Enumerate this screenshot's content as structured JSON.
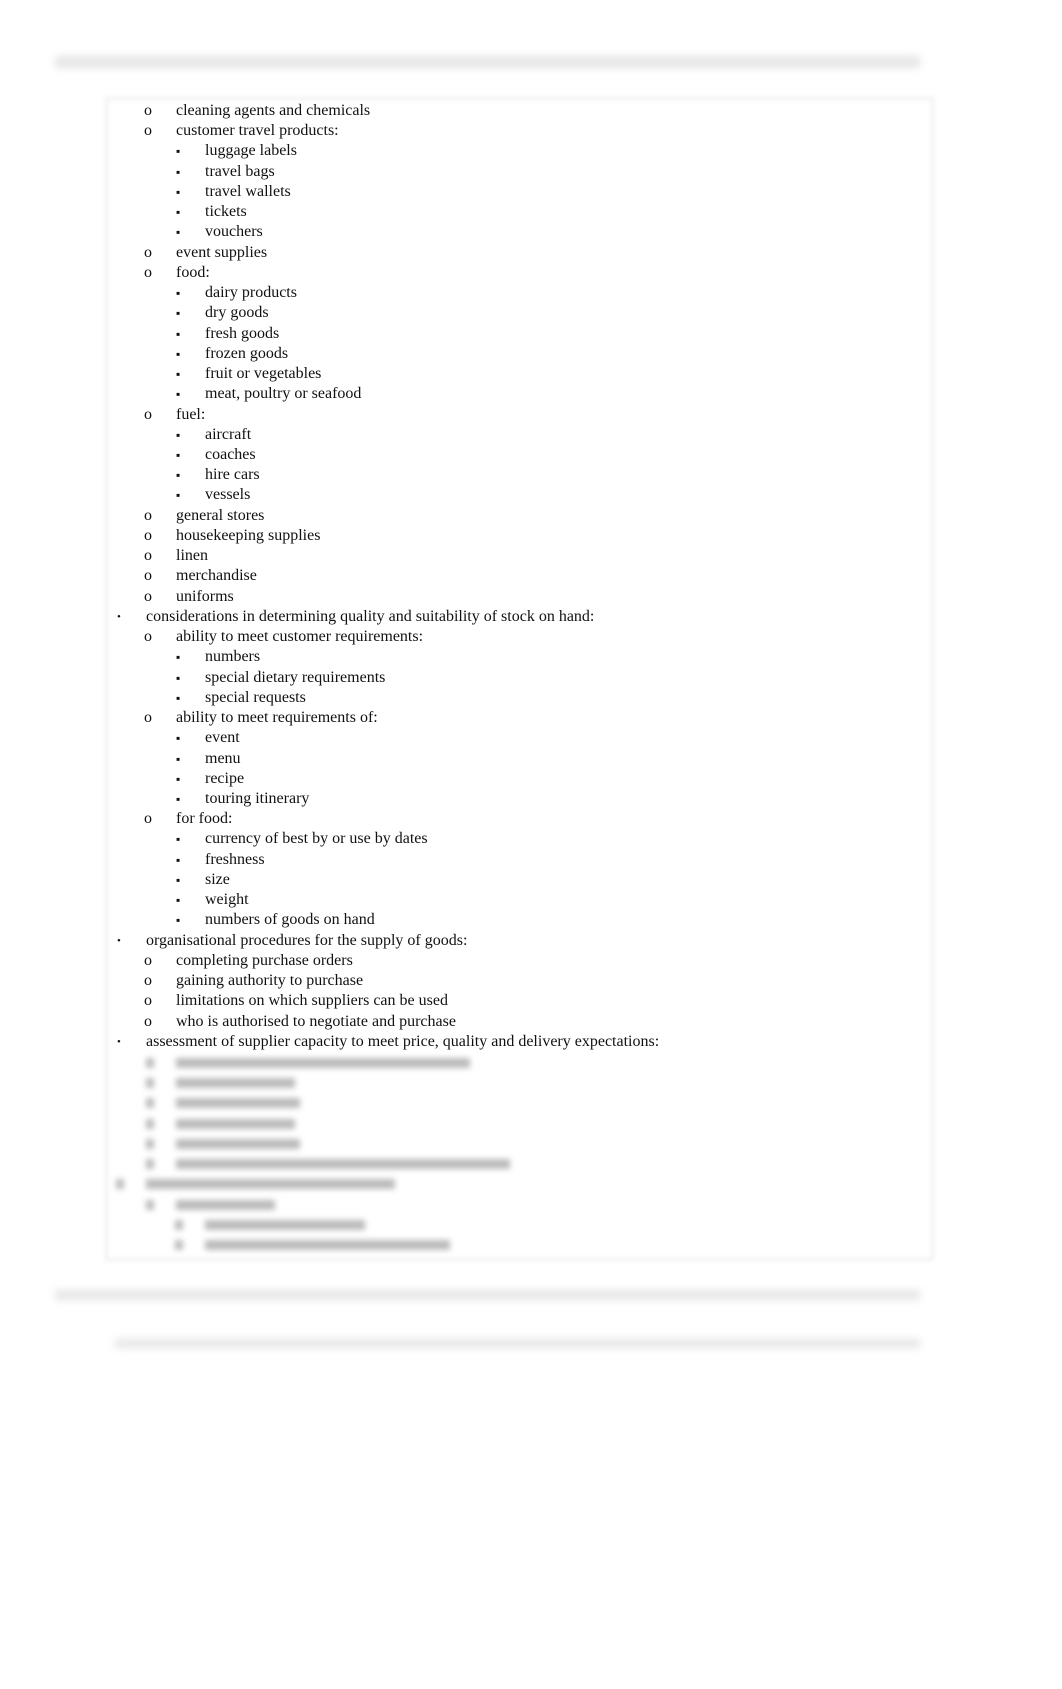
{
  "markers": {
    "1": "•",
    "2": "o",
    "3": "▪"
  },
  "items": [
    {
      "level": 2,
      "text": "cleaning agents and chemicals"
    },
    {
      "level": 2,
      "text": "customer travel products:"
    },
    {
      "level": 3,
      "text": "luggage labels"
    },
    {
      "level": 3,
      "text": "travel bags"
    },
    {
      "level": 3,
      "text": "travel wallets"
    },
    {
      "level": 3,
      "text": "tickets"
    },
    {
      "level": 3,
      "text": "vouchers"
    },
    {
      "level": 2,
      "text": "event supplies"
    },
    {
      "level": 2,
      "text": "food:"
    },
    {
      "level": 3,
      "text": "dairy products"
    },
    {
      "level": 3,
      "text": "dry goods"
    },
    {
      "level": 3,
      "text": "fresh goods"
    },
    {
      "level": 3,
      "text": "frozen goods"
    },
    {
      "level": 3,
      "text": "fruit or vegetables"
    },
    {
      "level": 3,
      "text": "meat, poultry or seafood"
    },
    {
      "level": 2,
      "text": "fuel:"
    },
    {
      "level": 3,
      "text": "aircraft"
    },
    {
      "level": 3,
      "text": "coaches"
    },
    {
      "level": 3,
      "text": "hire cars"
    },
    {
      "level": 3,
      "text": "vessels"
    },
    {
      "level": 2,
      "text": "general stores"
    },
    {
      "level": 2,
      "text": "housekeeping supplies"
    },
    {
      "level": 2,
      "text": "linen"
    },
    {
      "level": 2,
      "text": "merchandise"
    },
    {
      "level": 2,
      "text": "uniforms"
    },
    {
      "level": 1,
      "text": "considerations in determining quality and suitability of stock on hand:"
    },
    {
      "level": 2,
      "text": "ability to meet customer requirements:"
    },
    {
      "level": 3,
      "text": "numbers"
    },
    {
      "level": 3,
      "text": "special dietary requirements"
    },
    {
      "level": 3,
      "text": "special requests"
    },
    {
      "level": 2,
      "text": "ability to meet requirements of:"
    },
    {
      "level": 3,
      "text": "event"
    },
    {
      "level": 3,
      "text": "menu"
    },
    {
      "level": 3,
      "text": "recipe"
    },
    {
      "level": 3,
      "text": "touring itinerary"
    },
    {
      "level": 2,
      "text": "for food:"
    },
    {
      "level": 3,
      "text": "currency of best by or use by dates"
    },
    {
      "level": 3,
      "text": "freshness"
    },
    {
      "level": 3,
      "text": "size"
    },
    {
      "level": 3,
      "text": "weight"
    },
    {
      "level": 3,
      "text": "numbers of goods on hand"
    },
    {
      "level": 1,
      "text": "organisational procedures for the supply of goods:"
    },
    {
      "level": 2,
      "text": "completing purchase orders"
    },
    {
      "level": 2,
      "text": "gaining authority to purchase"
    },
    {
      "level": 2,
      "text": "limitations on which suppliers can be used"
    },
    {
      "level": 2,
      "text": "who is authorised to negotiate and purchase"
    },
    {
      "level": 1,
      "text": "assessment of supplier capacity to meet price, quality and delivery expectations:"
    }
  ]
}
